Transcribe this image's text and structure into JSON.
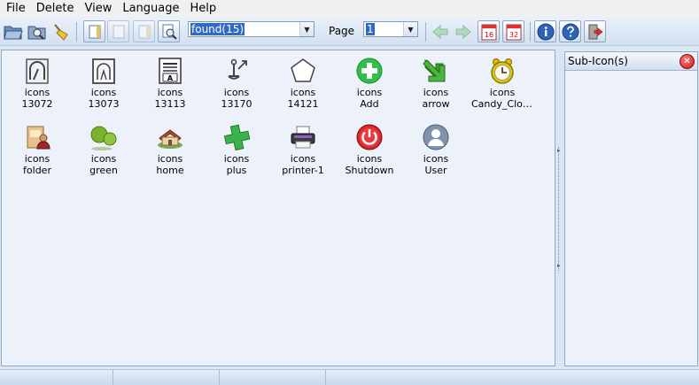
{
  "menu": [
    "File",
    "Delete",
    "View",
    "Language",
    "Help"
  ],
  "toolbar": {
    "search_value": "found(15)",
    "page_label": "Page",
    "page_value": "1",
    "calendar_16": "16",
    "calendar_32": "32"
  },
  "icons": [
    {
      "line1": "icons",
      "line2": "13072",
      "icon": "arch-outline-icon"
    },
    {
      "line1": "icons",
      "line2": "13073",
      "icon": "arch-frame-icon"
    },
    {
      "line1": "icons",
      "line2": "13113",
      "icon": "font-window-icon"
    },
    {
      "line1": "icons",
      "line2": "13170",
      "icon": "anchor-link-icon"
    },
    {
      "line1": "icons",
      "line2": "14121",
      "icon": "pentagon-icon"
    },
    {
      "line1": "icons",
      "line2": "Add",
      "icon": "add-plus-icon"
    },
    {
      "line1": "icons",
      "line2": "arrow",
      "icon": "green-arrow-down-icon"
    },
    {
      "line1": "icons",
      "line2": "Candy_Cloc...",
      "icon": "alarm-clock-icon"
    },
    {
      "line1": "icons",
      "line2": "folder",
      "icon": "user-folder-icon"
    },
    {
      "line1": "icons",
      "line2": "green",
      "icon": "green-people-icon"
    },
    {
      "line1": "icons",
      "line2": "home",
      "icon": "home-icon"
    },
    {
      "line1": "icons",
      "line2": "plus",
      "icon": "green-plus-icon"
    },
    {
      "line1": "icons",
      "line2": "printer-1",
      "icon": "printer-icon"
    },
    {
      "line1": "icons",
      "line2": "Shutdown",
      "icon": "power-icon"
    },
    {
      "line1": "icons",
      "line2": "User",
      "icon": "user-icon"
    }
  ],
  "side_panel": {
    "title": "Sub-Icon(s)",
    "close_glyph": "✕"
  },
  "splitter": {
    "arrow_up": "▸",
    "arrow_down": "▸"
  },
  "combo_arrow": "▼",
  "colors": {
    "accent": "#316ac5",
    "panel_bg": "#edf2fa",
    "toolbar_bg": "#dde8f5"
  }
}
